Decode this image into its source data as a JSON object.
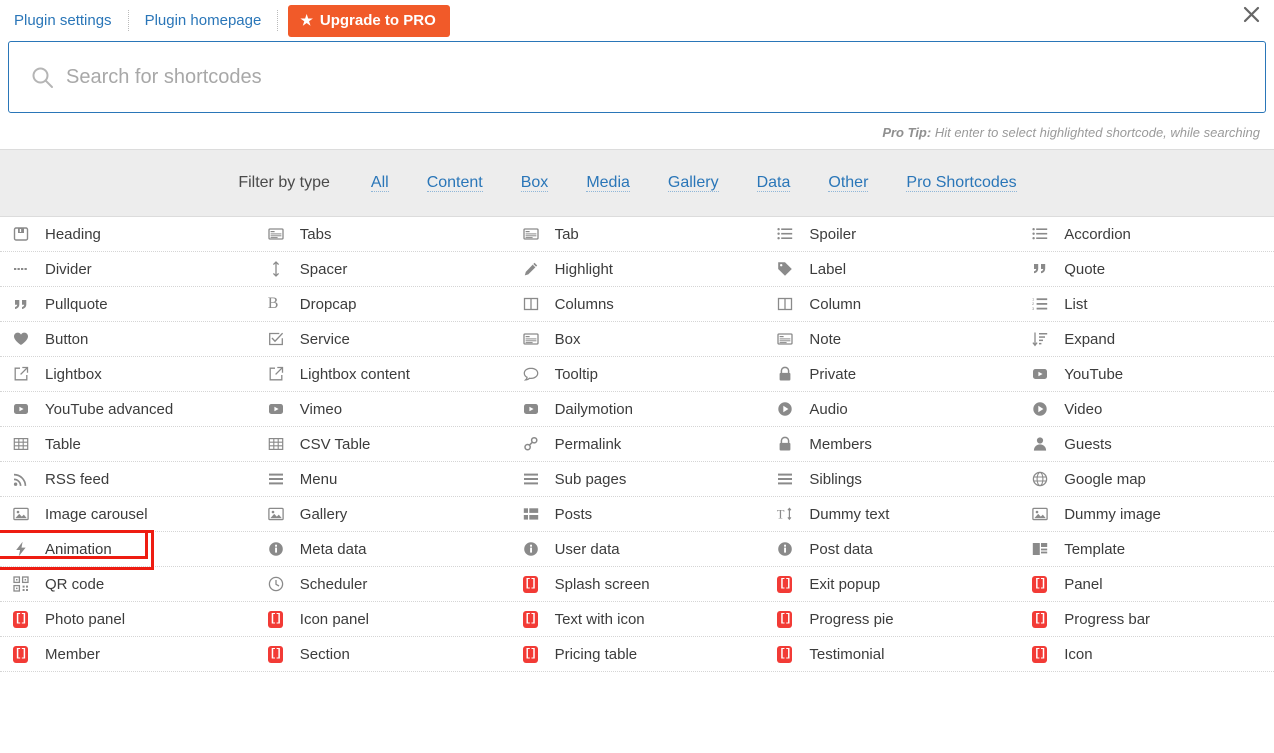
{
  "topbar": {
    "links": [
      {
        "label": "Plugin settings",
        "name": "plugin-settings-link"
      },
      {
        "label": "Plugin homepage",
        "name": "plugin-homepage-link"
      }
    ],
    "upgrade_button": {
      "label": "Upgrade to PRO",
      "icon": "star-icon",
      "color": "#f15a29"
    },
    "close_icon": "close-icon"
  },
  "search": {
    "placeholder": "Search for shortcodes",
    "value": "",
    "icon": "search-icon",
    "border_color": "#2a76b8"
  },
  "protip": {
    "label": "Pro Tip:",
    "text": " Hit enter to select highlighted shortcode, while searching"
  },
  "filter": {
    "label": "Filter by type",
    "options": [
      "All",
      "Content",
      "Box",
      "Media",
      "Gallery",
      "Data",
      "Other",
      "Pro Shortcodes"
    ]
  },
  "highlight": {
    "item": "Animation",
    "color": "#ee1c11"
  },
  "grid": {
    "columns": 5,
    "rows": [
      [
        {
          "label": "Heading",
          "icon": "heading-icon",
          "pro": false
        },
        {
          "label": "Tabs",
          "icon": "tabs-icon",
          "pro": false
        },
        {
          "label": "Tab",
          "icon": "tab-icon",
          "pro": false
        },
        {
          "label": "Spoiler",
          "icon": "spoiler-list-icon",
          "pro": false
        },
        {
          "label": "Accordion",
          "icon": "accordion-list-icon",
          "pro": false
        }
      ],
      [
        {
          "label": "Divider",
          "icon": "divider-dots-icon",
          "pro": false
        },
        {
          "label": "Spacer",
          "icon": "spacer-arrows-icon",
          "pro": false
        },
        {
          "label": "Highlight",
          "icon": "pencil-icon",
          "pro": false
        },
        {
          "label": "Label",
          "icon": "tag-icon",
          "pro": false
        },
        {
          "label": "Quote",
          "icon": "quote-icon",
          "pro": false
        }
      ],
      [
        {
          "label": "Pullquote",
          "icon": "pullquote-icon",
          "pro": false
        },
        {
          "label": "Dropcap",
          "icon": "dropcap-b-icon",
          "pro": false
        },
        {
          "label": "Columns",
          "icon": "columns-icon",
          "pro": false
        },
        {
          "label": "Column",
          "icon": "column-icon",
          "pro": false
        },
        {
          "label": "List",
          "icon": "ordered-list-icon",
          "pro": false
        }
      ],
      [
        {
          "label": "Button",
          "icon": "heart-icon",
          "pro": false
        },
        {
          "label": "Service",
          "icon": "check-square-icon",
          "pro": false
        },
        {
          "label": "Box",
          "icon": "box-icon",
          "pro": false
        },
        {
          "label": "Note",
          "icon": "note-icon",
          "pro": false
        },
        {
          "label": "Expand",
          "icon": "expand-sort-icon",
          "pro": false
        }
      ],
      [
        {
          "label": "Lightbox",
          "icon": "external-link-icon",
          "pro": false
        },
        {
          "label": "Lightbox content",
          "icon": "external-link-icon",
          "pro": false
        },
        {
          "label": "Tooltip",
          "icon": "speech-bubble-icon",
          "pro": false
        },
        {
          "label": "Private",
          "icon": "lock-icon",
          "pro": false
        },
        {
          "label": "YouTube",
          "icon": "youtube-icon",
          "pro": false
        }
      ],
      [
        {
          "label": "YouTube advanced",
          "icon": "youtube-icon",
          "pro": false
        },
        {
          "label": "Vimeo",
          "icon": "youtube-icon",
          "pro": false
        },
        {
          "label": "Dailymotion",
          "icon": "youtube-icon",
          "pro": false
        },
        {
          "label": "Audio",
          "icon": "play-circle-icon",
          "pro": false
        },
        {
          "label": "Video",
          "icon": "play-circle-icon",
          "pro": false
        }
      ],
      [
        {
          "label": "Table",
          "icon": "table-icon",
          "pro": false
        },
        {
          "label": "CSV Table",
          "icon": "table-icon",
          "pro": false
        },
        {
          "label": "Permalink",
          "icon": "link-icon",
          "pro": false
        },
        {
          "label": "Members",
          "icon": "lock-icon",
          "pro": false
        },
        {
          "label": "Guests",
          "icon": "user-icon",
          "pro": false
        }
      ],
      [
        {
          "label": "RSS feed",
          "icon": "rss-icon",
          "pro": false
        },
        {
          "label": "Menu",
          "icon": "menu-bars-icon",
          "pro": false
        },
        {
          "label": "Sub pages",
          "icon": "menu-bars-icon",
          "pro": false
        },
        {
          "label": "Siblings",
          "icon": "menu-bars-icon",
          "pro": false
        },
        {
          "label": "Google map",
          "icon": "globe-icon",
          "pro": false
        }
      ],
      [
        {
          "label": "Image carousel",
          "icon": "image-icon",
          "pro": false
        },
        {
          "label": "Gallery",
          "icon": "image-icon",
          "pro": false
        },
        {
          "label": "Posts",
          "icon": "posts-grid-icon",
          "pro": false
        },
        {
          "label": "Dummy text",
          "icon": "dummy-text-icon",
          "pro": false
        },
        {
          "label": "Dummy image",
          "icon": "image-icon",
          "pro": false
        }
      ],
      [
        {
          "label": "Animation",
          "icon": "bolt-icon",
          "pro": false
        },
        {
          "label": "Meta data",
          "icon": "info-icon",
          "pro": false
        },
        {
          "label": "User data",
          "icon": "info-icon",
          "pro": false
        },
        {
          "label": "Post data",
          "icon": "info-icon",
          "pro": false
        },
        {
          "label": "Template",
          "icon": "template-icon",
          "pro": false
        }
      ],
      [
        {
          "label": "QR code",
          "icon": "qr-code-icon",
          "pro": false
        },
        {
          "label": "Scheduler",
          "icon": "clock-icon",
          "pro": false
        },
        {
          "label": "Splash screen",
          "icon": "pro-badge-icon",
          "pro": true
        },
        {
          "label": "Exit popup",
          "icon": "pro-badge-icon",
          "pro": true
        },
        {
          "label": "Panel",
          "icon": "pro-badge-icon",
          "pro": true
        }
      ],
      [
        {
          "label": "Photo panel",
          "icon": "pro-badge-icon",
          "pro": true
        },
        {
          "label": "Icon panel",
          "icon": "pro-badge-icon",
          "pro": true
        },
        {
          "label": "Text with icon",
          "icon": "pro-badge-icon",
          "pro": true
        },
        {
          "label": "Progress pie",
          "icon": "pro-badge-icon",
          "pro": true
        },
        {
          "label": "Progress bar",
          "icon": "pro-badge-icon",
          "pro": true
        }
      ],
      [
        {
          "label": "Member",
          "icon": "pro-badge-icon",
          "pro": true
        },
        {
          "label": "Section",
          "icon": "pro-badge-icon",
          "pro": true
        },
        {
          "label": "Pricing table",
          "icon": "pro-badge-icon",
          "pro": true
        },
        {
          "label": "Testimonial",
          "icon": "pro-badge-icon",
          "pro": true
        },
        {
          "label": "Icon",
          "icon": "pro-badge-icon",
          "pro": true
        }
      ]
    ]
  }
}
